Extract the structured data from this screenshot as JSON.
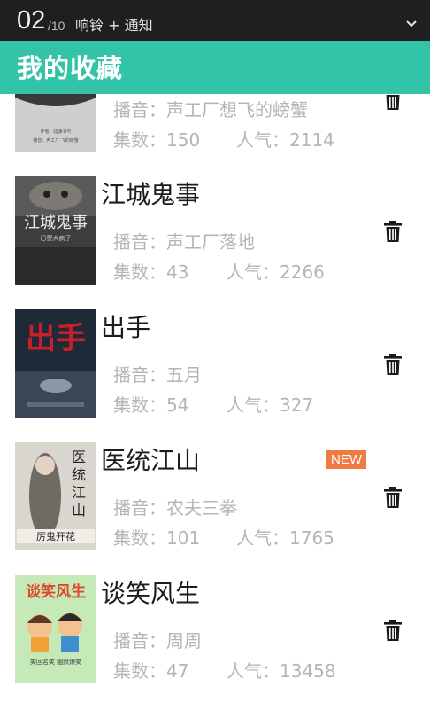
{
  "status_bar": {
    "current": "02",
    "total": "/10",
    "label": "响铃 + 通知"
  },
  "header": {
    "title": "我的收藏"
  },
  "items": [
    {
      "title": "",
      "anchor": "播音：声工厂想飞的螃蟹",
      "episodes": "集数：150",
      "popularity": "人气：2114",
      "cover_text": "作者 · 陆谦书号\n播音：声工厂·飞的螃蟹",
      "new": ""
    },
    {
      "title": "江城鬼事",
      "anchor": "播音：声工厂落地",
      "episodes": "集数：43",
      "popularity": "人气：2266",
      "cover_text": "江城鬼事\n〇贾大疯子",
      "new": ""
    },
    {
      "title": "出手",
      "anchor": "播音：五月",
      "episodes": "集数：54",
      "popularity": "人气：327",
      "cover_text": "出手",
      "new": ""
    },
    {
      "title": "医统江山",
      "anchor": "播音：农夫三拳",
      "episodes": "集数：101",
      "popularity": "人气：1765",
      "cover_text": "医统江山\n厉鬼开花",
      "new": "NEW"
    },
    {
      "title": "谈笑风生",
      "anchor": "播音：周周",
      "episodes": "集数：47",
      "popularity": "人气：13458",
      "cover_text": "谈笑风生\n笑回名笑  幽默爆笑",
      "new": ""
    }
  ],
  "colors": {
    "accent": "#33c4a8",
    "status_bar": "#1f1f1f",
    "badge": "#f07a43",
    "meta_text": "#b5b5b5"
  }
}
